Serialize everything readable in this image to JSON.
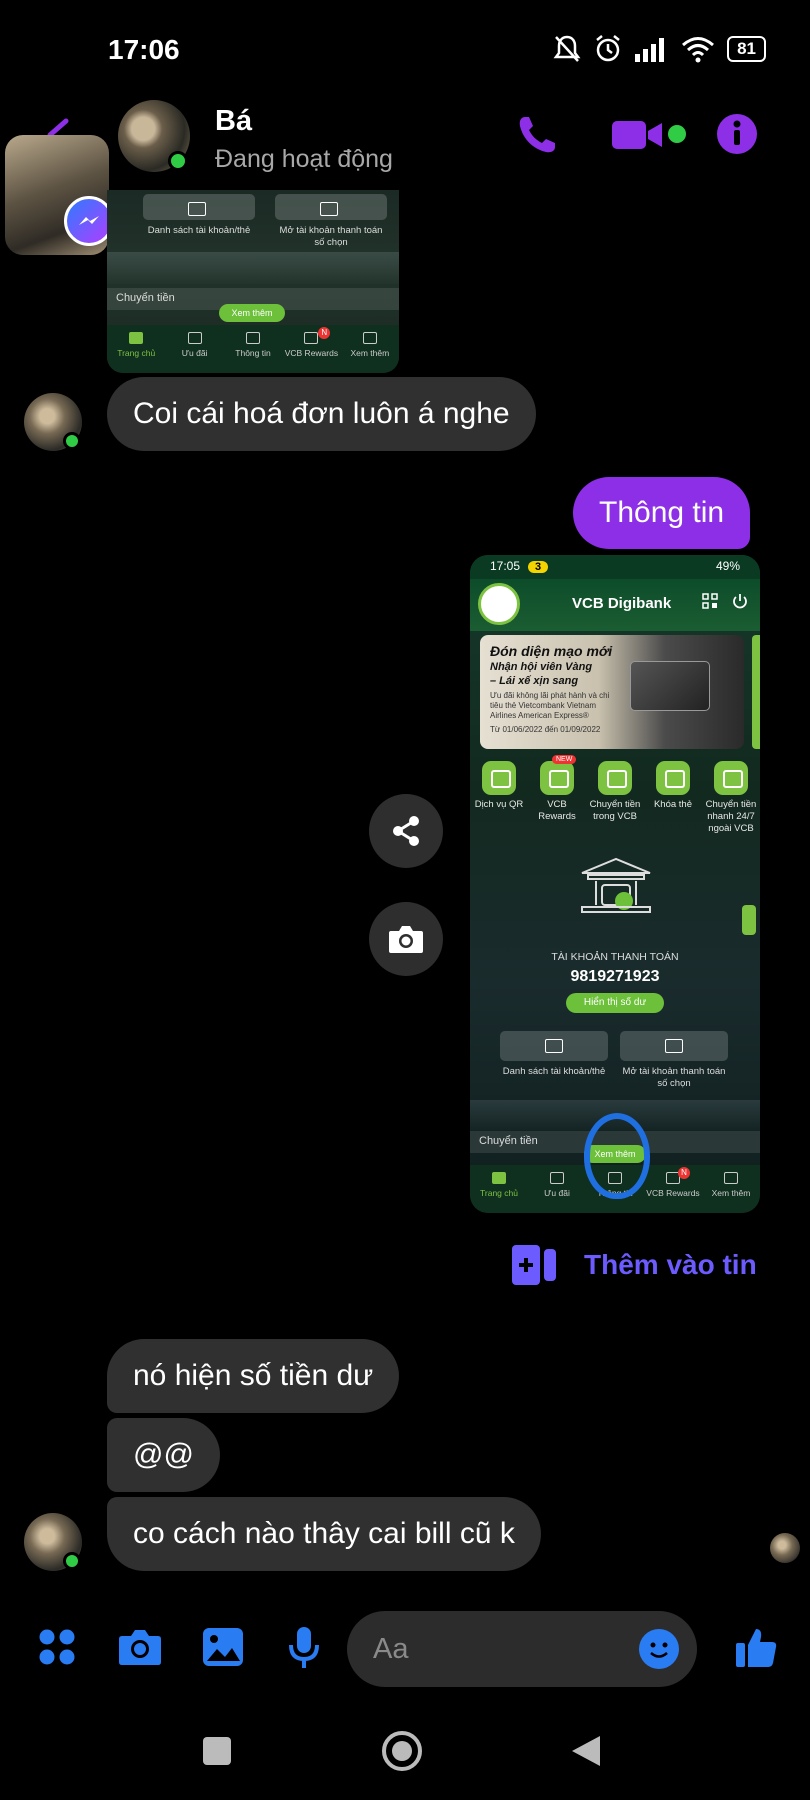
{
  "status_bar": {
    "time": "17:06",
    "battery": "81"
  },
  "header": {
    "contact_name": "Bá",
    "contact_status": "Đang hoạt động"
  },
  "partial_screenshot": {
    "tiles": [
      "Danh sách tài khoản/thẻ",
      "Mở tài khoản thanh toán số chọn"
    ],
    "transfer_label": "Chuyển tiền",
    "more_button": "Xem thêm",
    "nav": [
      "Trang chủ",
      "Ưu đãi",
      "Thông tin",
      "VCB Rewards",
      "Xem thêm"
    ],
    "nav_badge": "N"
  },
  "messages": {
    "m1": "Coi cái hoá đơn luôn á nghe",
    "m2_out": "Thông tin",
    "m3": "nó hiện số tiền dư",
    "m4": "@@",
    "m5": "co cách nào thây cai bill cũ k"
  },
  "vcb_screenshot": {
    "time": "17:05",
    "badge": "3",
    "battery": "49%",
    "app_title": "VCB Digibank",
    "banner": {
      "title": "Đón diện mạo mới",
      "subtitle1": "Nhận hội viên Vàng",
      "subtitle2": "– Lái xế xịn sang",
      "small": "Ưu đãi không lãi phát hành và chi tiêu thẻ Vietcombank Vietnam Airlines American Express®",
      "dates": "Từ 01/06/2022 đến 01/09/2022"
    },
    "new_tag": "NEW",
    "services": [
      "Dịch vụ QR",
      "VCB Rewards",
      "Chuyển tiền trong VCB",
      "Khóa thẻ",
      "Chuyển tiền nhanh 24/7 ngoài VCB"
    ],
    "account_label": "TÀI KHOẢN THANH TOÁN",
    "account_number": "9819271923",
    "show_balance": "Hiển thị số dư",
    "tiles": [
      "Danh sách tài khoản/thẻ",
      "Mở tài khoản thanh toán số chọn"
    ],
    "transfer_label": "Chuyển tiền",
    "more_button": "Xem thêm",
    "nav": [
      "Trang chủ",
      "Ưu đãi",
      "Thông tin",
      "VCB Rewards",
      "Xem thêm"
    ],
    "nav_badge": "N"
  },
  "add_story_label": "Thêm vào tin",
  "composer": {
    "placeholder": "Aa"
  },
  "colors": {
    "accent": "#8e2fe8",
    "messenger_blue": "#2a7cf2",
    "online": "#31cc46",
    "vcb_green": "#7ec242"
  },
  "icons": [
    "back-arrow-icon",
    "phone-icon",
    "video-icon",
    "info-icon",
    "share-icon",
    "camera-icon",
    "add-story-icon",
    "apps-icon",
    "gallery-icon",
    "mic-icon",
    "emoji-icon",
    "like-icon"
  ]
}
